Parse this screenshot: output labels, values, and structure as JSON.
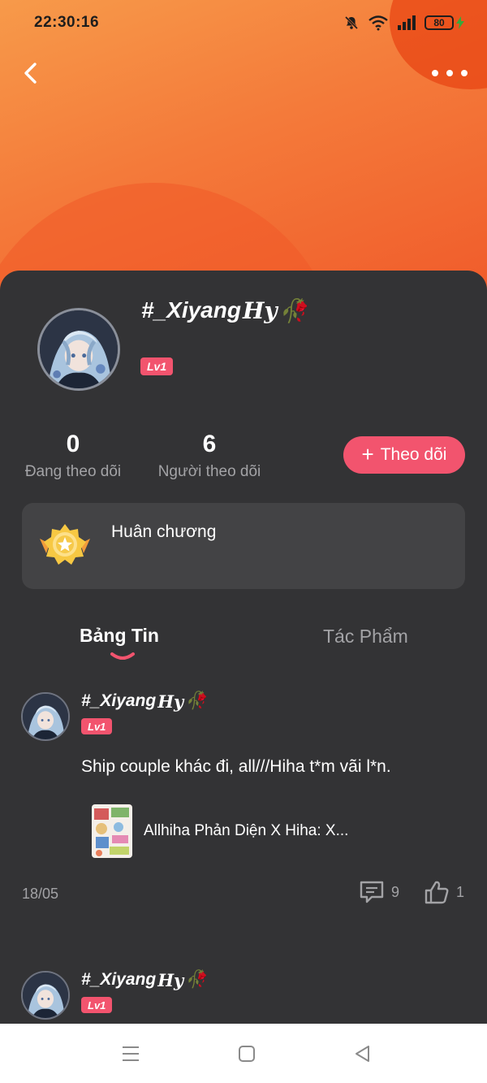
{
  "status_bar": {
    "time": "22:30:16",
    "battery_level": "80",
    "icons": [
      "mute-icon",
      "wifi-icon",
      "signal-icon",
      "battery-icon",
      "charging-icon"
    ]
  },
  "nav": {
    "back_icon": "chevron-left-icon",
    "more_icon": "more-horizontal-icon"
  },
  "profile": {
    "name": "#_Xiyang",
    "name_suffix": "𝑯𝒚",
    "name_emoji": "🥀",
    "level": "Lv1",
    "following_count": "0",
    "following_label": "Đang theo dõi",
    "followers_count": "6",
    "followers_label": "Người theo dõi",
    "follow_button": "Theo dõi",
    "follow_icon": "+"
  },
  "medals": {
    "label": "Huân chương"
  },
  "tabs": [
    {
      "label": "Bảng Tin",
      "active": true
    },
    {
      "label": "Tác Phẩm",
      "active": false
    }
  ],
  "posts": [
    {
      "author": "#_Xiyang",
      "author_suffix": "𝑯𝒚",
      "author_emoji": "🥀",
      "level": "Lv1",
      "text": "Ship couple khác đi, all///Hiha t*m vãi l*n.",
      "attached_title": "Allhiha Phản Diện X Hiha: X...",
      "date": "18/05",
      "comments": "9",
      "likes": "1"
    },
    {
      "author": "#_Xiyang",
      "author_suffix": "𝑯𝒚",
      "author_emoji": "🥀",
      "level": "Lv1"
    }
  ],
  "colors": {
    "accent": "#f2546e",
    "header_orange": "#f47a3a",
    "card_bg": "#333335",
    "panel_bg": "#434345",
    "muted_text": "#a3a3a6"
  }
}
